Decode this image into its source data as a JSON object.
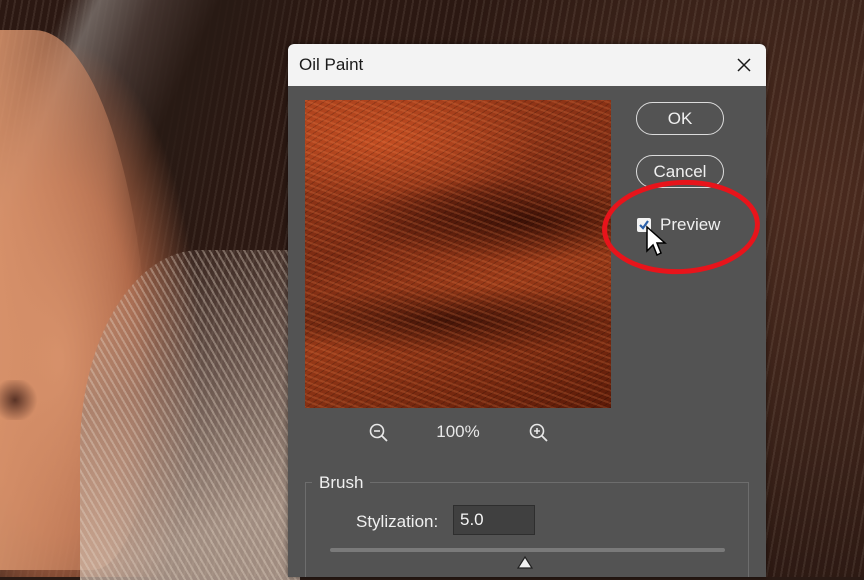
{
  "dialog": {
    "title": "Oil Paint",
    "ok_label": "OK",
    "cancel_label": "Cancel",
    "preview_label": "Preview",
    "preview_checked": true,
    "zoom_level": "100%"
  },
  "brush": {
    "group_label": "Brush",
    "stylization_label": "Stylization:",
    "stylization_value": "5.0"
  },
  "icons": [
    "close-icon",
    "zoom-out-icon",
    "zoom-in-icon",
    "checkmark-icon",
    "cursor-icon",
    "slider-thumb-icon"
  ],
  "colors": {
    "dialog_bg": "#535353",
    "titlebar_bg": "#f3f3f3",
    "highlight": "#e8141b"
  }
}
